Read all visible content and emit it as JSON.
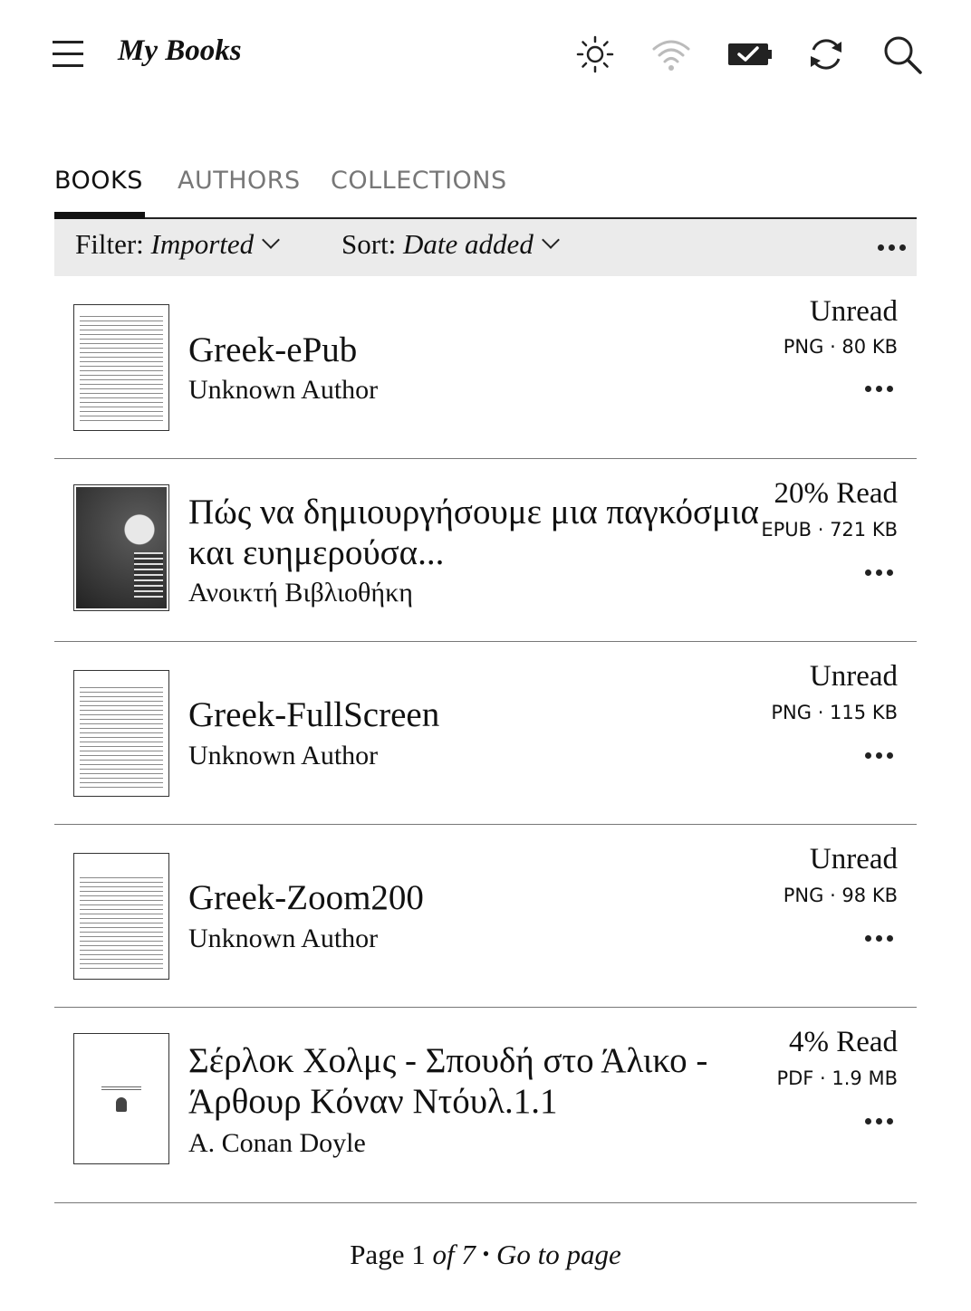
{
  "header": {
    "title": "My Books",
    "icons": [
      "menu-icon",
      "brightness-icon",
      "wifi-icon",
      "battery-icon",
      "sync-icon",
      "search-icon"
    ]
  },
  "tabs": [
    {
      "label": "BOOKS",
      "active": true
    },
    {
      "label": "AUTHORS",
      "active": false
    },
    {
      "label": "COLLECTIONS",
      "active": false
    }
  ],
  "filter_bar": {
    "filter_label": "Filter:",
    "filter_value": "Imported",
    "sort_label": "Sort:",
    "sort_value": "Date added"
  },
  "books": [
    {
      "title": "Greek-ePub",
      "author": "Unknown Author",
      "status": "Unread",
      "meta": "PNG · 80 KB"
    },
    {
      "title": "Πώς να δημιουργήσουμε μια παγκόσμια και ευημερούσα...",
      "author": "Ανοικτή Βιβλιοθήκη",
      "status": "20% Read",
      "meta": "EPUB · 721 KB"
    },
    {
      "title": "Greek-FullScreen",
      "author": "Unknown Author",
      "status": "Unread",
      "meta": "PNG · 115 KB"
    },
    {
      "title": "Greek-Zoom200",
      "author": "Unknown Author",
      "status": "Unread",
      "meta": "PNG · 98 KB"
    },
    {
      "title": "Σέρλοκ Χολμς - Σπουδή στο Άλικο - Άρθουρ Κόναν Ντόυλ.1.1",
      "author": "A. Conan Doyle",
      "status": "4% Read",
      "meta": "PDF · 1.9 MB"
    }
  ],
  "pager": {
    "page_word": "Page",
    "current": "1",
    "of_word": "of",
    "total": "7",
    "separator": "•",
    "go_to_page": "Go to page"
  }
}
